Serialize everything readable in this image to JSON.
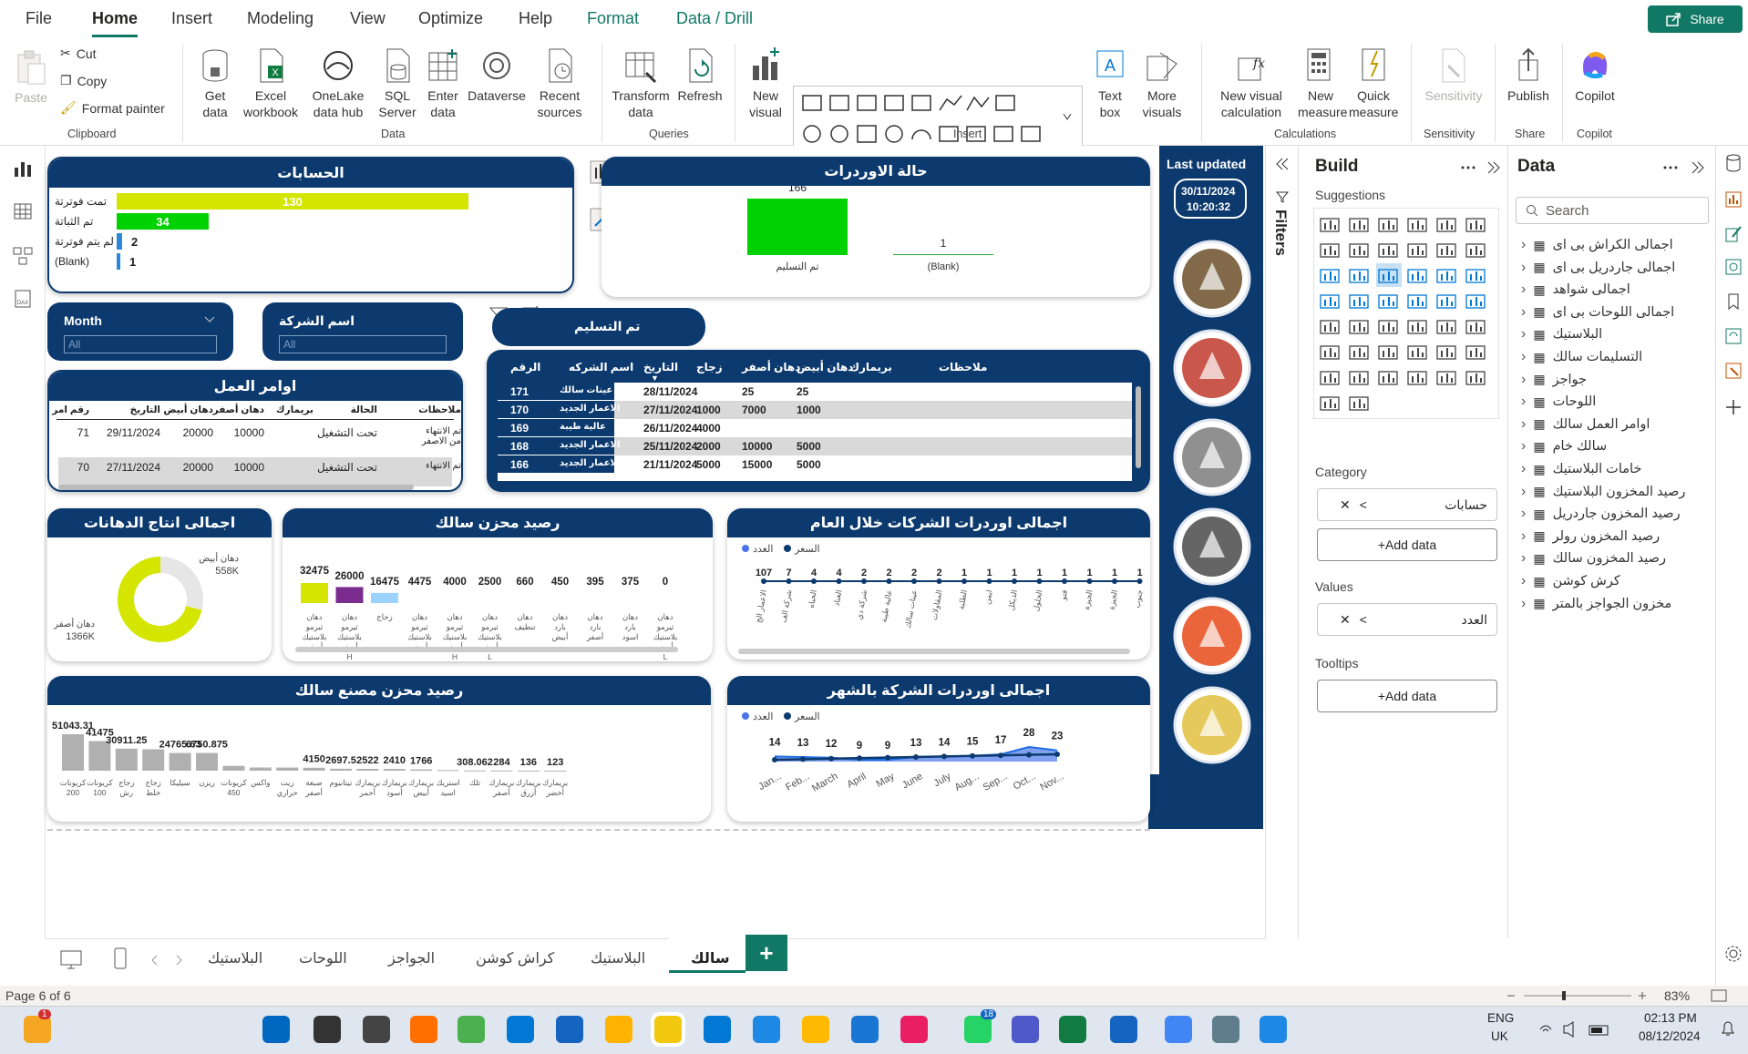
{
  "ribbon_tabs": [
    "File",
    "Home",
    "Insert",
    "Modeling",
    "View",
    "Optimize",
    "Help",
    "Format",
    "Data / Drill"
  ],
  "share_label": "Share",
  "clipboard": {
    "paste": "Paste",
    "cut": "Cut",
    "copy": "Copy",
    "format_painter": "Format painter",
    "group": "Clipboard"
  },
  "data_group": {
    "get_data": "Get data",
    "excel": "Excel workbook",
    "onelake": "OneLake data hub",
    "sql": "SQL Server",
    "enter": "Enter data",
    "dataverse": "Dataverse",
    "recent": "Recent sources",
    "group": "Data"
  },
  "queries": {
    "transform": "Transform data",
    "refresh": "Refresh",
    "group": "Queries"
  },
  "insert": {
    "new_visual": "New visual",
    "text_box": "Text box",
    "more_visuals": "More visuals",
    "group": "Insert"
  },
  "calculations": {
    "new_visual_calc": "New visual calculation",
    "new_measure": "New measure",
    "quick_measure": "Quick measure",
    "group": "Calculations"
  },
  "sensitivity": {
    "label": "Sensitivity",
    "group": "Sensitivity"
  },
  "share": {
    "publish": "Publish",
    "group": "Share"
  },
  "copilot": {
    "label": "Copilot",
    "group": "Copilot"
  },
  "accounts": {
    "title": "الحسابات",
    "rows": [
      {
        "label": "تمت فوترتة",
        "value": "130"
      },
      {
        "label": "تم الثباتة",
        "value": "34"
      },
      {
        "label": "لم يتم فوترتة",
        "value": "2"
      },
      {
        "label": "(Blank)",
        "value": "1"
      }
    ],
    "values": [
      130,
      34,
      2,
      1
    ]
  },
  "orders_status": {
    "title": "حالة الاوردرات",
    "bars": [
      {
        "label": "تم التسليم",
        "value": "166"
      },
      {
        "label": "(Blank)",
        "value": "1"
      }
    ],
    "values": [
      166,
      1
    ]
  },
  "last_updated": {
    "label": "Last updated",
    "date": "30/11/2024",
    "time": "10:20:32"
  },
  "slicers": {
    "month_label": "Month",
    "month_value": "All",
    "company_label": "اسم الشركة",
    "company_value": "All",
    "delivered": "تم التسليم"
  },
  "work_orders": {
    "title": "اوامر العمل",
    "headers": [
      "ملاحظات",
      "الحالة",
      "بريمارك",
      "دهان أصفر",
      "دهان أبيض",
      "التاريخ",
      "رقم امر العمل"
    ],
    "rows": [
      [
        "تم الانتهاء من الاصفر",
        "تحت التشغيل",
        "",
        "10000",
        "20000",
        "29/11/2024",
        "71"
      ],
      [
        "تم الانتهاء",
        "تحت التشغيل",
        "",
        "10000",
        "20000",
        "27/11/2024",
        "70"
      ]
    ]
  },
  "orders_table": {
    "headers": [
      "ملاحظات",
      "بريمارك",
      "دهان أبيض",
      "دهان أصفر",
      "زجاج",
      "التاريخ",
      "اسم الشركه",
      "الرقم"
    ],
    "rows": [
      [
        "",
        "",
        "25",
        "25",
        "",
        "28/11/2024",
        "عينات سالك",
        "171"
      ],
      [
        "",
        "",
        "1000",
        "7000",
        "1000",
        "27/11/2024",
        "الاعمار الجديد",
        "170"
      ],
      [
        "",
        "",
        "",
        "",
        "4000",
        "26/11/2024",
        "عالية طيبة",
        "169"
      ],
      [
        "",
        "",
        "5000",
        "10000",
        "2000",
        "25/11/2024",
        "الاعمار الجديد",
        "168"
      ],
      [
        "",
        "",
        "5000",
        "15000",
        "5000",
        "21/11/2024",
        "الاعمار الجديد",
        "166"
      ]
    ]
  },
  "paint_production": {
    "title": "اجمالى انتاج الدهانات",
    "slices": [
      {
        "label": "دهان أبيض",
        "value": "558K"
      },
      {
        "label": "دهان أصفر",
        "value": "1366K"
      }
    ],
    "values": [
      558,
      1366
    ]
  },
  "salek_stock": {
    "title": "رصيد محزن سالك",
    "items": [
      {
        "v": "32475",
        "l": "دهان ثيرمو بلاستيك أصفر"
      },
      {
        "v": "26000",
        "l": "دهان ثيرمو بلاستيك أصفر H"
      },
      {
        "v": "16475",
        "l": "زجاج"
      },
      {
        "v": "4475",
        "l": "دهان ثيرمو بلاستيك أبيض"
      },
      {
        "v": "4000",
        "l": "دهان ثيرمو بلاستيك أبيض H"
      },
      {
        "v": "2500",
        "l": "دهان ثيرمو بلاستيك أصفر L"
      },
      {
        "v": "660",
        "l": "دهان تنظيف"
      },
      {
        "v": "450",
        "l": "دهان بارد أبيض"
      },
      {
        "v": "395",
        "l": "دهان بارد أصفر"
      },
      {
        "v": "375",
        "l": "دهان بارد اسود"
      },
      {
        "v": "0",
        "l": "دهان ثيرمو بلاستيك أبيض L"
      }
    ],
    "values": [
      32475,
      26000,
      16475,
      4475,
      4000,
      2500,
      660,
      450,
      395,
      375,
      0
    ]
  },
  "companies_orders": {
    "title": "اجمالى اوردرات الشركات خلال العام",
    "legend": [
      "العدد",
      "السعر"
    ],
    "values": [
      107,
      7,
      4,
      4,
      2,
      2,
      2,
      2,
      1,
      1,
      1,
      1,
      1,
      1,
      1,
      1
    ],
    "labels": [
      "الاعمار الج",
      "شركة الف",
      "الحياه",
      "العناد",
      "شركة دي",
      "عالية طيبة",
      "عينات سالك",
      "المقاولات",
      "الطلبة",
      "ايمن",
      "الذيكل",
      "الحلول",
      "فتو",
      "الجيزة",
      "الجيزة",
      "جنوب"
    ]
  },
  "factory_stock": {
    "title": "رصيد محزن مصنع سالك",
    "items": [
      {
        "v": "51043.31",
        "l": "كريونات 200"
      },
      {
        "v": "41475",
        "l": "كريونات 100"
      },
      {
        "v": "30911.25",
        "l": "زجاج رش"
      },
      {
        "v": "",
        "l": "زجاج خلط"
      },
      {
        "v": "24765.63",
        "l": "سيليكا"
      },
      {
        "v": "6750.875",
        "l": "ريزن"
      },
      {
        "v": "",
        "l": "كريونات 450"
      },
      {
        "v": "",
        "l": "واكس"
      },
      {
        "v": "",
        "l": "زيت حراري"
      },
      {
        "v": "4150",
        "l": "صبغة أصفر"
      },
      {
        "v": "2697.5",
        "l": "تيتانيوم"
      },
      {
        "v": "2522",
        "l": "بريمارك أحمر"
      },
      {
        "v": "2410",
        "l": "بريمارك أسود"
      },
      {
        "v": "1766",
        "l": "بريمارك أبيض"
      },
      {
        "v": "",
        "l": "استريك اسيد"
      },
      {
        "v": "308.062",
        "l": "تلك"
      },
      {
        "v": "284",
        "l": "بريمارك أصفر"
      },
      {
        "v": "136",
        "l": "بريمارك أزرق"
      },
      {
        "v": "123",
        "l": "بريمارك أخضر"
      }
    ],
    "values": [
      51043.31,
      41475,
      30911.25,
      30000,
      24765.63,
      24765,
      6750.875,
      4500,
      4400,
      4150,
      2697.5,
      2522,
      2410,
      1766,
      900,
      308.062,
      284,
      136,
      123
    ]
  },
  "monthly_orders": {
    "title": "اجمالى اوردرات الشركة بالشهر",
    "legend": [
      "العدد",
      "السعر"
    ],
    "values": [
      14,
      13,
      12,
      9,
      9,
      13,
      14,
      15,
      17,
      28,
      23
    ],
    "months": [
      "Jan...",
      "Feb...",
      "March",
      "April",
      "May",
      "June",
      "July",
      "Aug...",
      "Sep...",
      "Oct...",
      "Nov..."
    ]
  },
  "page_tabs": [
    "البلاستيك",
    "اللوحات",
    "الجواجز",
    "كراش كوشن",
    "البلاستيك",
    "سالك"
  ],
  "status": {
    "page": "Page 6 of 6",
    "zoom": "83%"
  },
  "build": {
    "title": "Build",
    "suggestions": "Suggestions",
    "category": "Category",
    "category_value": "حسابات",
    "values": "Values",
    "values_value": "العدد",
    "tooltips": "Tooltips",
    "add_data": "+Add data"
  },
  "data_pane": {
    "title": "Data",
    "search": "Search",
    "tables": [
      "اجمالى الكراش بى اى",
      "اجمالى جاردريل بى اى",
      "اجمالى شواهد",
      "اجمالى اللوحات بى اى",
      "البلاستيك",
      "التسليمات سالك",
      "جواجز",
      "اللوحات",
      "اوامر العمل سالك",
      "سالك خام",
      "خامات البلاستيك",
      "رصيد المخزون البلاستيك",
      "رصيد المخزون جاردريل",
      "رصيد المخزون رولر",
      "رصيد المخزون سالك",
      "كرش كوشن",
      "مخزون الجواجز بالمتر"
    ]
  },
  "filters_label": "Filters",
  "taskbar": {
    "lang": "ENG",
    "region": "UK",
    "time": "02:13 PM",
    "date": "08/12/2024",
    "badge_whatsapp": "18",
    "badge_weather": "1"
  },
  "colors": {
    "navy": "#0c3a6e",
    "teal": "#117865",
    "lime": "#d4e600",
    "green": "#00d100",
    "purple": "#7b2c8f",
    "lightblue": "#9cd2ff",
    "blue": "#4a74e8"
  }
}
